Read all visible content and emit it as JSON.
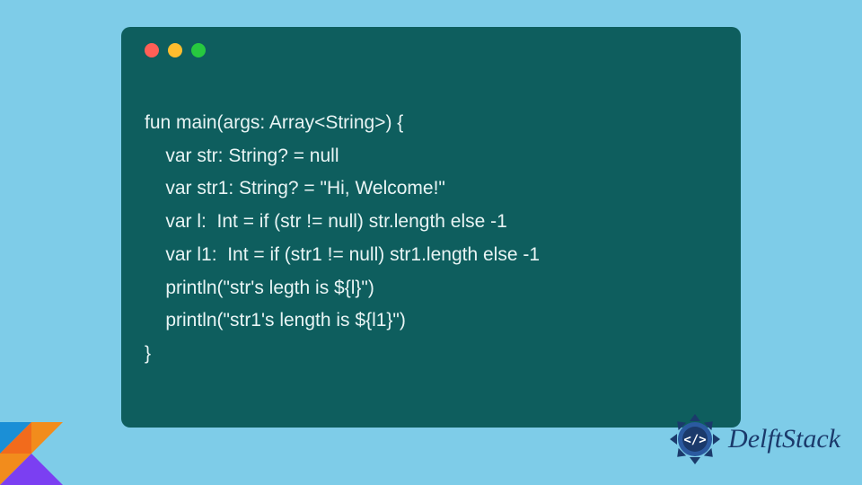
{
  "code": {
    "lines": [
      "fun main(args: Array<String>) {",
      "    var str: String? = null",
      "    var str1: String? = \"Hi, Welcome!\"",
      "    var l:  Int = if (str != null) str.length else -1",
      "    var l1:  Int = if (str1 != null) str1.length else -1",
      "    println(\"str's legth is ${l}\")",
      "    println(\"str1's length is ${l1}\")",
      "}"
    ]
  },
  "brand": {
    "name": "DelftStack"
  },
  "colors": {
    "page_bg": "#7ecce8",
    "window_bg": "#0e5e5e",
    "code_text": "#e8f4f4",
    "brand_text": "#1b3a6b"
  }
}
